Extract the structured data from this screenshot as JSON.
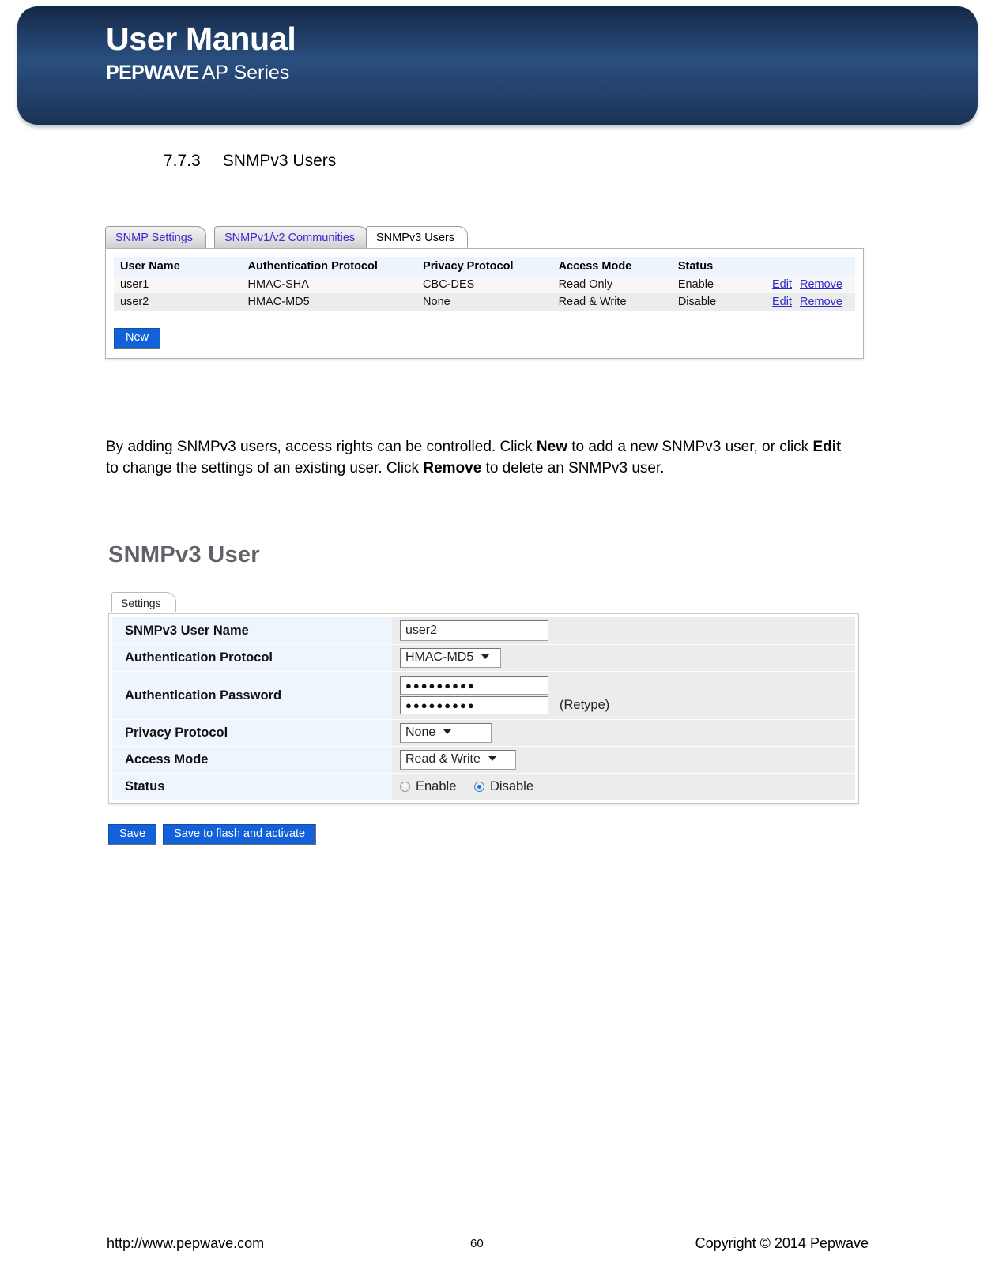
{
  "header": {
    "title": "User Manual",
    "brand_bold": "PEPWAVE",
    "brand_rest": "AP Series"
  },
  "section": {
    "number": "7.7.3",
    "title": "SNMPv3 Users"
  },
  "users_panel": {
    "tabs": [
      {
        "label": "SNMP Settings",
        "active": false
      },
      {
        "label": "SNMPv1/v2 Communities",
        "active": false
      },
      {
        "label": "SNMPv3 Users",
        "active": true
      }
    ],
    "columns": [
      "User Name",
      "Authentication Protocol",
      "Privacy Protocol",
      "Access Mode",
      "Status",
      ""
    ],
    "rows": [
      {
        "user_name": "user1",
        "auth_protocol": "HMAC-SHA",
        "privacy_protocol": "CBC-DES",
        "access_mode": "Read Only",
        "status": "Enable",
        "edit": "Edit",
        "remove": "Remove"
      },
      {
        "user_name": "user2",
        "auth_protocol": "HMAC-MD5",
        "privacy_protocol": "None",
        "access_mode": "Read & Write",
        "status": "Disable",
        "edit": "Edit",
        "remove": "Remove"
      }
    ],
    "new_button": "New"
  },
  "paragraph": {
    "p1": "By adding SNMPv3 users, access rights can be controlled. Click ",
    "b1": "New",
    "p2": " to add a new SNMPv3 user, or click ",
    "b2": "Edit",
    "p3": " to change the settings of an existing user. Click ",
    "b3": "Remove",
    "p4": " to delete an SNMPv3 user."
  },
  "user_form": {
    "title": "SNMPv3 User",
    "tab_label": "Settings",
    "labels": {
      "user_name": "SNMPv3 User Name",
      "auth_protocol": "Authentication Protocol",
      "auth_password": "Authentication Password",
      "privacy_protocol": "Privacy Protocol",
      "access_mode": "Access Mode",
      "status": "Status"
    },
    "values": {
      "user_name": "user2",
      "auth_protocol": "HMAC-MD5",
      "auth_password": "●●●●●●●●●",
      "auth_password_retype": "●●●●●●●●●",
      "retype_note": "(Retype)",
      "privacy_protocol": "None",
      "access_mode": "Read & Write",
      "status_enable": "Enable",
      "status_disable": "Disable",
      "status_selected": "Disable"
    },
    "buttons": {
      "save": "Save",
      "save_flash": "Save to flash and activate"
    }
  },
  "footer": {
    "url": "http://www.pepwave.com",
    "page_number": "60",
    "copyright": "Copyright ©  2014  Pepwave"
  },
  "colors": {
    "banner_blue": "#2a4f7f",
    "button_blue": "#1261d8",
    "link_blue": "#2d2ccc",
    "label_bg": "#eff5fd",
    "value_bg": "#ececec"
  }
}
